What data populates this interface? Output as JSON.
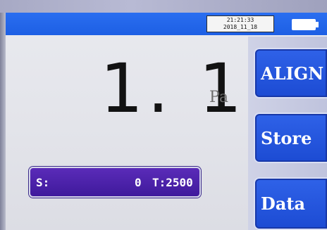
{
  "status": {
    "time": "21:21:33",
    "date": "2018_11_18"
  },
  "reading": {
    "value": "1. 1",
    "unit": "Pa"
  },
  "info_bar": {
    "s_label": "S:",
    "s_value": "0",
    "t_label": "T:2500"
  },
  "buttons": {
    "align": "ALIGN",
    "store": "Store",
    "data": "Data"
  },
  "colors": {
    "status_bar": "#1d5fe4",
    "button_blue": "#2f62e8",
    "info_bar_purple": "#4a20a8",
    "background": "#e6e7ec"
  }
}
